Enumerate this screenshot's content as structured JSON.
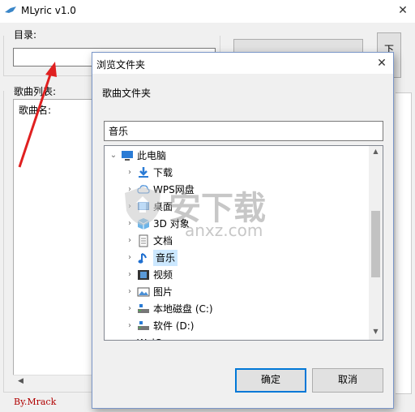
{
  "window": {
    "title": "MLyric v1.0",
    "close_glyph": "✕"
  },
  "directory": {
    "label": "目录:",
    "value": ""
  },
  "right_button": {
    "label": "下"
  },
  "song_list": {
    "label": "歌曲列表:",
    "header": "歌曲名:"
  },
  "signature": "By.Mrack",
  "dialog": {
    "title": "浏览文件夹",
    "close_glyph": "✕",
    "description": "歌曲文件夹",
    "path_value": "音乐",
    "tree": [
      {
        "label": "此电脑",
        "icon": "computer-icon",
        "level": 0,
        "expanded": true
      },
      {
        "label": "下载",
        "icon": "download-icon",
        "level": 1
      },
      {
        "label": "WPS网盘",
        "icon": "cloud-icon",
        "level": 1
      },
      {
        "label": "桌面",
        "icon": "desktop-icon",
        "level": 1
      },
      {
        "label": "3D 对象",
        "icon": "cube-icon",
        "level": 1
      },
      {
        "label": "文档",
        "icon": "document-icon",
        "level": 1
      },
      {
        "label": "音乐",
        "icon": "music-icon",
        "level": 1,
        "selected": true
      },
      {
        "label": "视频",
        "icon": "video-icon",
        "level": 1
      },
      {
        "label": "图片",
        "icon": "picture-icon",
        "level": 1
      },
      {
        "label": "本地磁盘 (C:)",
        "icon": "drive-icon",
        "level": 1
      },
      {
        "label": "软件 (D:)",
        "icon": "drive-icon",
        "level": 1
      },
      {
        "label": "WeiC...",
        "icon": "folder-icon",
        "level": 0
      }
    ],
    "ok_label": "确定",
    "cancel_label": "取消"
  },
  "watermark": {
    "text": "安下载",
    "subtext": "anxz.com"
  },
  "colors": {
    "accent": "#0078d7",
    "selection": "#cce8ff",
    "signature": "#b00000",
    "arrow": "#e02020"
  }
}
